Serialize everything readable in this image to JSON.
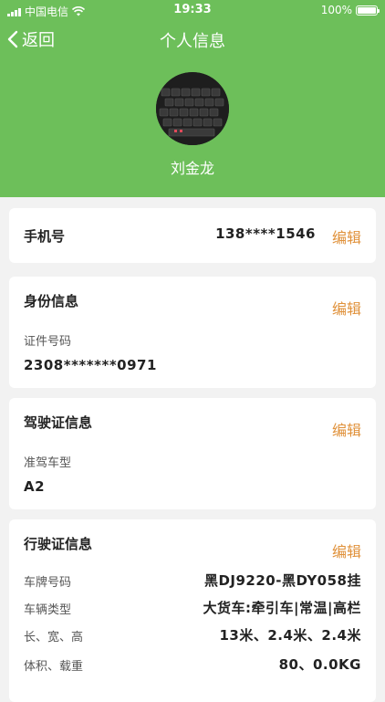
{
  "status_bar": {
    "carrier": "中国电信",
    "time": "19:33",
    "battery": "100%"
  },
  "nav": {
    "back_label": "返回",
    "title": "个人信息"
  },
  "profile": {
    "name": "刘金龙"
  },
  "phone_card": {
    "title": "手机号",
    "value": "138****1546",
    "edit_label": "编辑"
  },
  "id_card": {
    "title": "身份信息",
    "edit_label": "编辑",
    "field_label": "证件号码",
    "field_value": "2308*******0971"
  },
  "license_card": {
    "title": "驾驶证信息",
    "edit_label": "编辑",
    "field_label": "准驾车型",
    "field_value": "A2"
  },
  "vehicle_card": {
    "title": "行驶证信息",
    "edit_label": "编辑",
    "rows": [
      {
        "label": "车牌号码",
        "value": "黑DJ9220-黑DY058挂"
      },
      {
        "label": "车辆类型",
        "value": "大货车:牵引车|常温|高栏"
      },
      {
        "label": "长、宽、高",
        "value": "13米、2.4米、2.4米"
      },
      {
        "label": "体积、载重",
        "value": "80、0.0KG"
      }
    ]
  },
  "colors": {
    "header_green": "#6dbf5a",
    "edit_orange": "#e0913a",
    "background": "#f2f2f2"
  }
}
